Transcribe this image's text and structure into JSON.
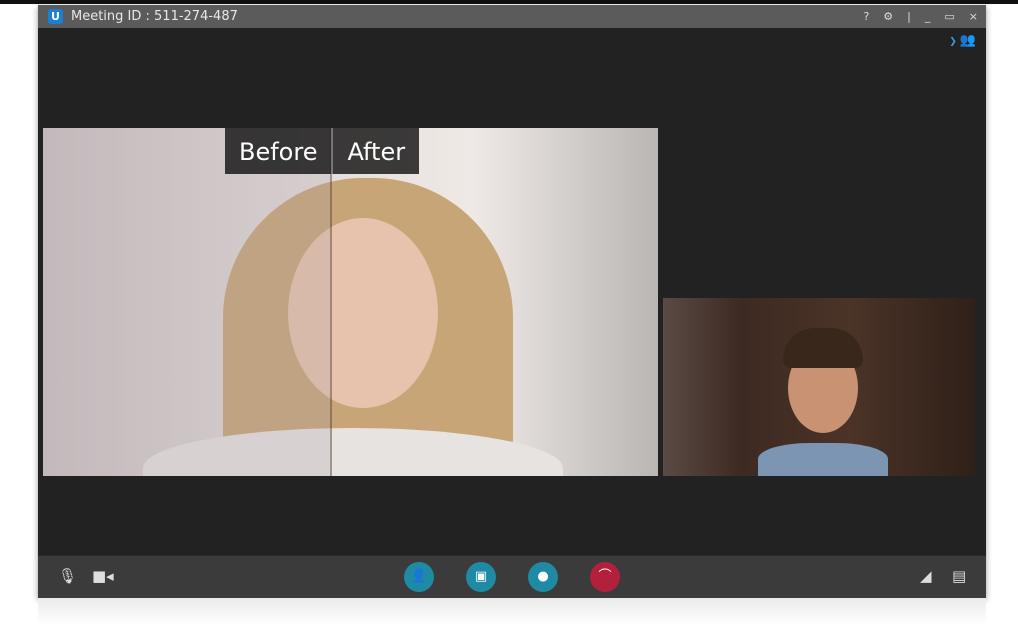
{
  "window": {
    "logo_letter": "U",
    "title": "Meeting ID : 511-274-487",
    "controls": {
      "help": "?",
      "settings": "⚙",
      "separator": "|",
      "minimize": "_",
      "maximize": "▭",
      "close": "×"
    }
  },
  "participants_icon": "people-icon",
  "main_video": {
    "before_label": "Before",
    "after_label": "After"
  },
  "toolbar": {
    "left": [
      "microphone-icon",
      "camera-icon"
    ],
    "center": [
      "invite-participant",
      "share-screen",
      "record",
      "end-call"
    ],
    "right": [
      "signal-icon",
      "chat-icon"
    ]
  },
  "colors": {
    "accent": "#1e8aa4",
    "end_call": "#b3203c",
    "titlebar": "#5b5b5b"
  }
}
